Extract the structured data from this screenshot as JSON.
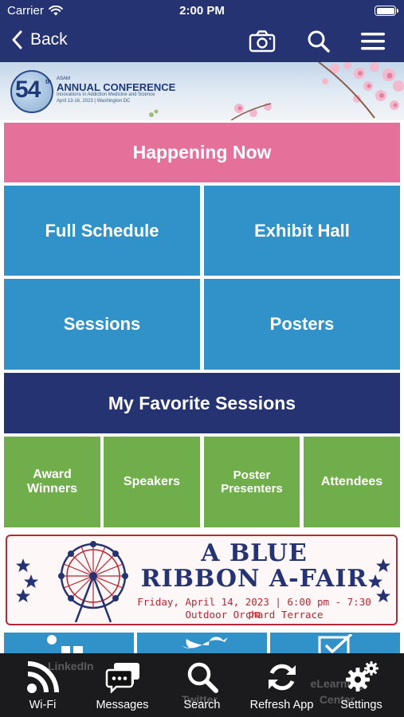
{
  "status_bar": {
    "carrier": "Carrier",
    "time": "2:00 PM"
  },
  "nav": {
    "back_label": "Back"
  },
  "banner": {
    "number": "54",
    "ordinal": "th",
    "org": "ASAM",
    "title": "ANNUAL CONFERENCE",
    "subtitle": "Innovations in Addiction Medicine and Science",
    "dates": "April 13-16, 2023  |  Washington DC"
  },
  "tiles": {
    "happening_now": "Happening Now",
    "full_schedule": "Full Schedule",
    "exhibit_hall": "Exhibit Hall",
    "sessions": "Sessions",
    "posters": "Posters",
    "my_favorite_sessions": "My Favorite Sessions",
    "award_winners": "Award Winners",
    "speakers": "Speakers",
    "poster_presenters": "Poster Presenters",
    "attendees": "Attendees"
  },
  "promo": {
    "line1": "A BLUE",
    "line2": "RIBBON A-FAIR",
    "when": "Friday, April 14, 2023 | 6:00 pm - 7:30 pm",
    "where": "Outdoor Orchard Terrace"
  },
  "social_row": {
    "linkedin": "LinkedIn",
    "twitter": "Twitter",
    "elearning": "eLearning Center"
  },
  "tab_bar": {
    "wifi": "Wi-Fi",
    "messages": "Messages",
    "search": "Search",
    "refresh": "Refresh App",
    "settings": "Settings"
  },
  "colors": {
    "navy": "#253373",
    "blue": "#3191c9",
    "pink": "#e5719b",
    "green": "#70ad4b",
    "red": "#b92733"
  }
}
